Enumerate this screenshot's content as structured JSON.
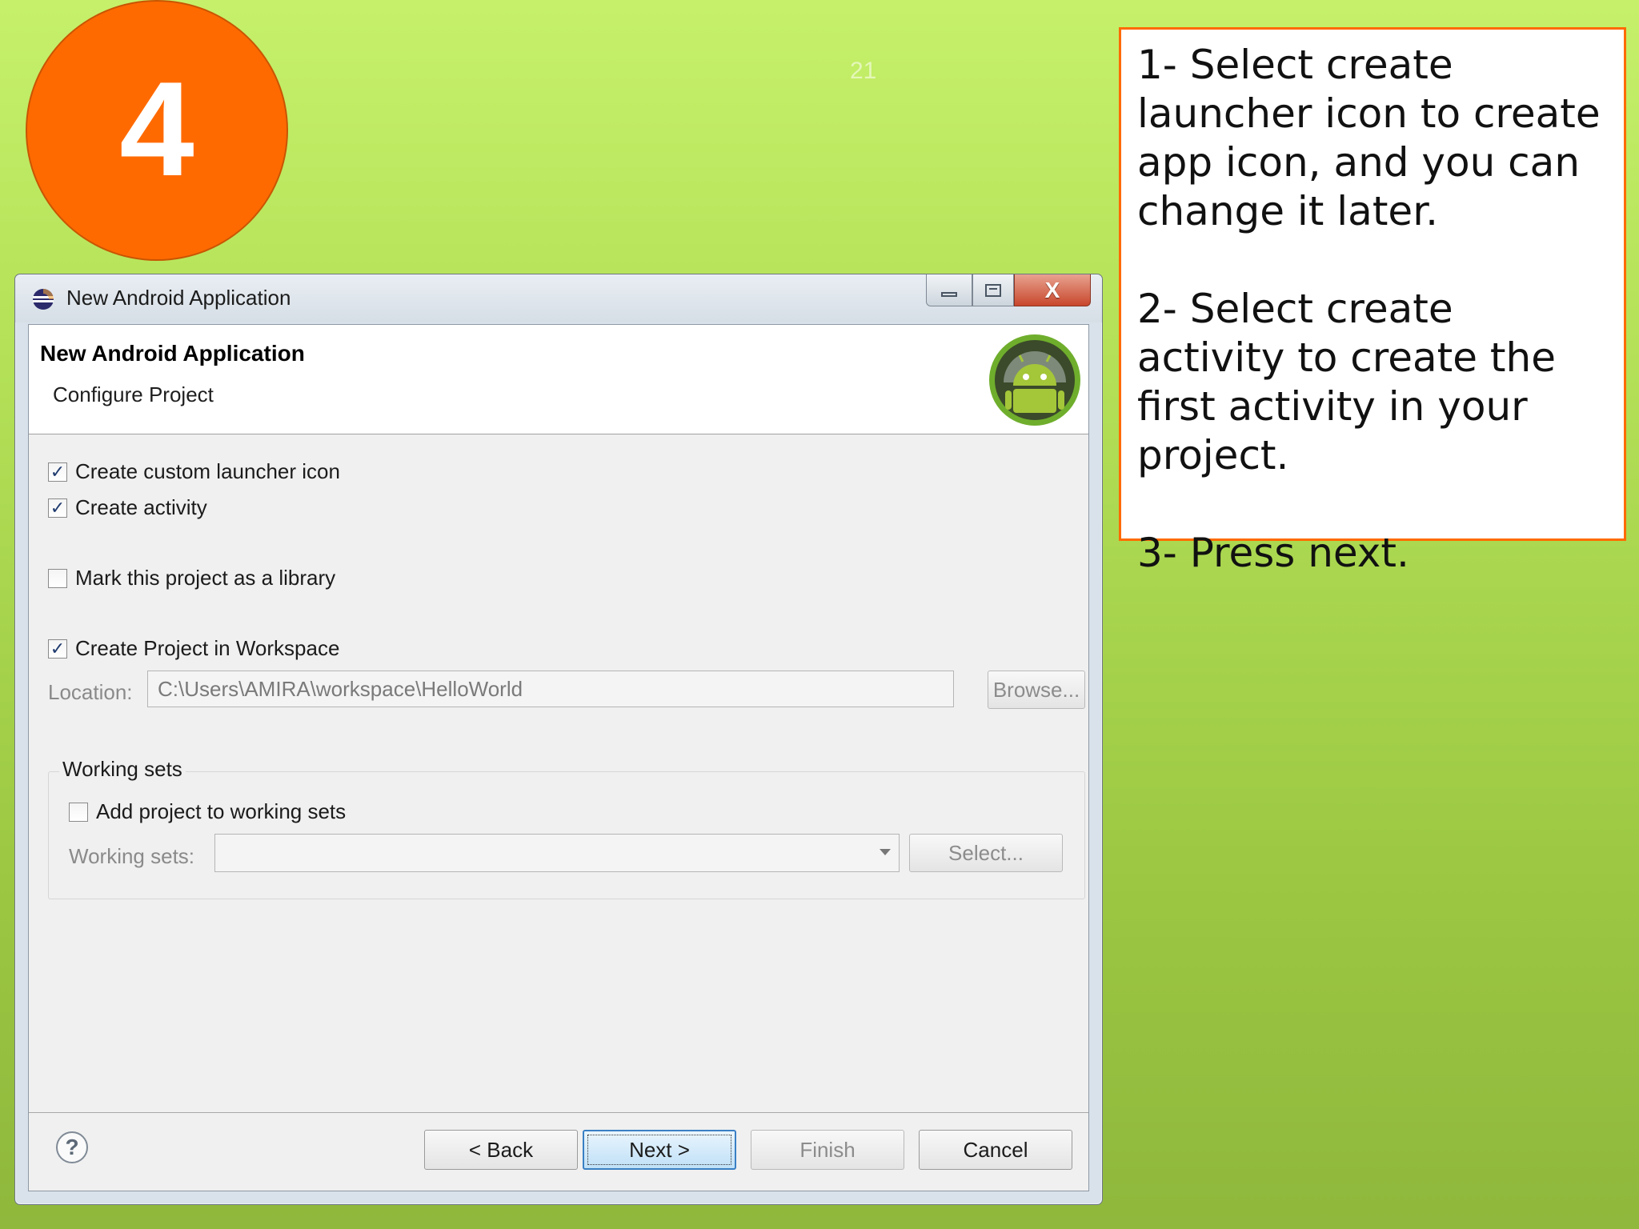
{
  "slide": {
    "step_number": "4",
    "page_number": "21",
    "instructions": [
      "1- Select create launcher icon to create app icon, and you can change it later.",
      "2- Select create activity to create the first activity in your project.",
      "3- Press next."
    ],
    "colors": {
      "accent": "#ff6a00",
      "background_top": "#c6f06a",
      "background_bottom": "#8fb83c"
    }
  },
  "window": {
    "title": "New Android Application",
    "icons": {
      "app": "eclipse-icon",
      "minimize": "minimize-icon",
      "maximize": "maximize-icon",
      "close": "close-icon"
    },
    "close_glyph": "X"
  },
  "dialog": {
    "title": "New Android Application",
    "subtitle": "Configure Project",
    "logo": "android-logo"
  },
  "options": {
    "create_launcher_icon": {
      "label": "Create custom launcher icon",
      "checked": true
    },
    "create_activity": {
      "label": "Create activity",
      "checked": true
    },
    "mark_library": {
      "label": "Mark this project as a library",
      "checked": false
    },
    "create_in_workspace": {
      "label": "Create Project in Workspace",
      "checked": true
    }
  },
  "location": {
    "label": "Location:",
    "value": "C:\\Users\\AMIRA\\workspace\\HelloWorld",
    "browse_label": "Browse..."
  },
  "working_sets": {
    "group_title": "Working sets",
    "add_label": "Add project to working sets",
    "add_checked": false,
    "field_label": "Working sets:",
    "selected_value": "",
    "select_button": "Select..."
  },
  "footer": {
    "help_glyph": "?",
    "back_label": "< Back",
    "next_label": "Next >",
    "finish_label": "Finish",
    "cancel_label": "Cancel"
  }
}
